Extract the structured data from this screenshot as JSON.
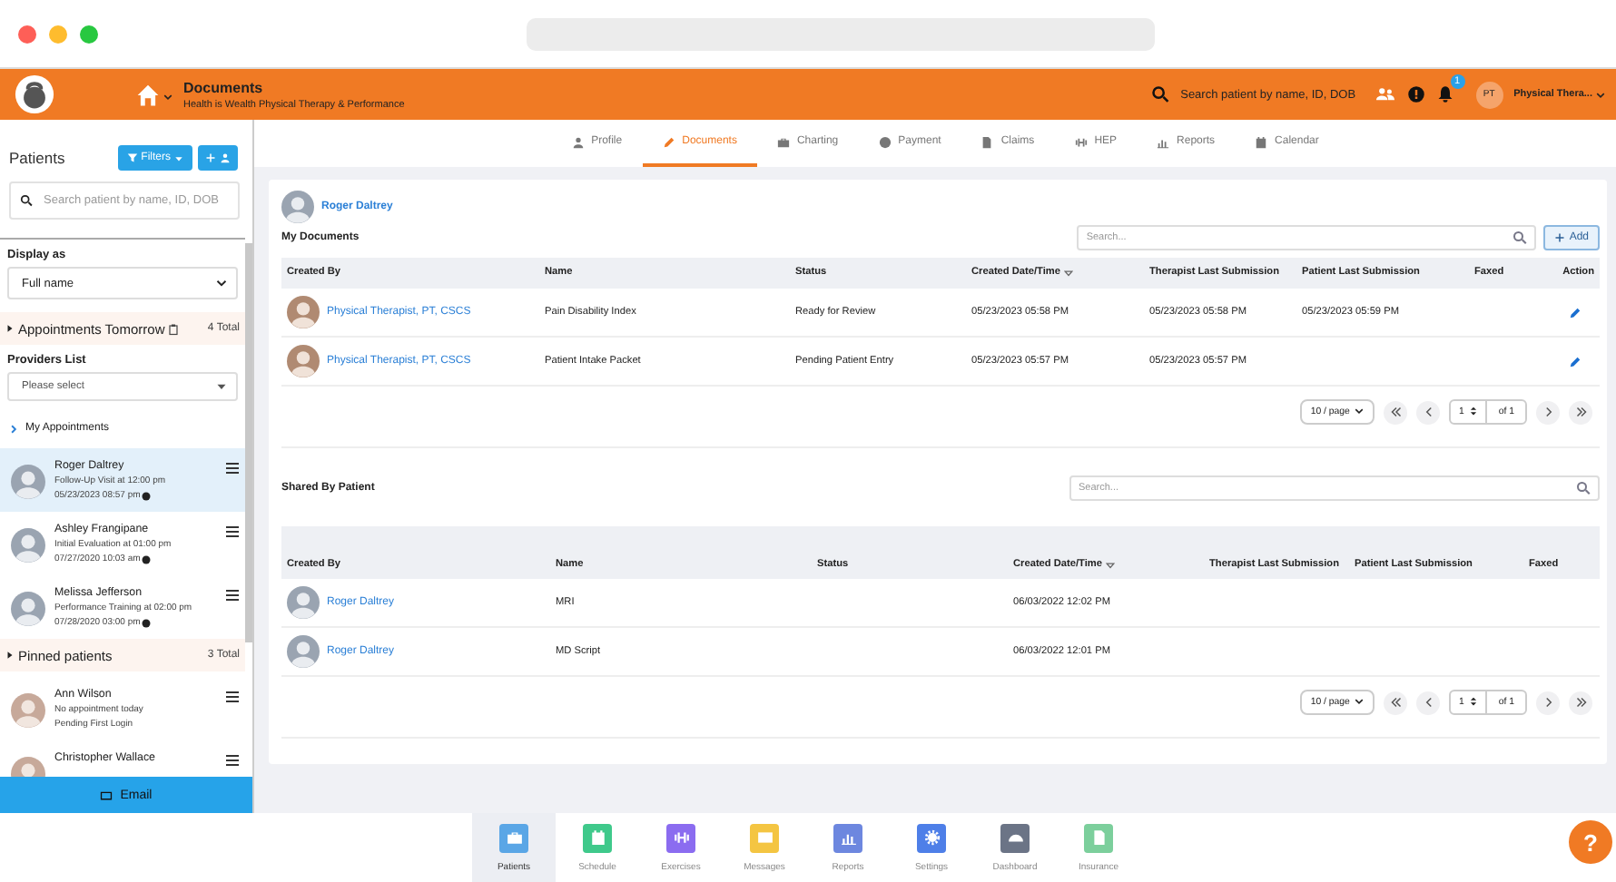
{
  "header": {
    "title": "Documents",
    "subtitle": "Health is Wealth Physical Therapy & Performance",
    "search_placeholder": "Search patient by name, ID, DOB",
    "notification_count": "1",
    "user_initials": "PT",
    "user_name": "Physical Thera..."
  },
  "sidebar": {
    "title": "Patients",
    "filters_button": "Filters",
    "search_placeholder": "Search patient by name, ID, DOB",
    "display_as_label": "Display as",
    "display_as_value": "Full name",
    "appointments_section": {
      "title": "Appointments Tomorrow",
      "total": "4 Total"
    },
    "providers_label": "Providers List",
    "providers_placeholder": "Please select",
    "my_appointments": "My Appointments",
    "appointments": [
      {
        "name": "Roger Daltrey",
        "line1": "Follow-Up Visit at 12:00 pm",
        "line2": "05/23/2023 08:57 pm",
        "selected": true
      },
      {
        "name": "Ashley Frangipane",
        "line1": "Initial Evaluation at 01:00 pm",
        "line2": "07/27/2020 10:03 am",
        "selected": false
      },
      {
        "name": "Melissa Jefferson",
        "line1": "Performance Training at 02:00 pm",
        "line2": "07/28/2020 03:00 pm",
        "selected": false
      }
    ],
    "pinned_section": {
      "title": "Pinned patients",
      "total": "3 Total"
    },
    "pinned": [
      {
        "name": "Ann Wilson",
        "line1": "No appointment today",
        "line2": "Pending First Login"
      },
      {
        "name": "Christopher Wallace"
      }
    ],
    "email_button": "Email"
  },
  "tabs": [
    {
      "label": "Profile",
      "selected": false
    },
    {
      "label": "Documents",
      "selected": true
    },
    {
      "label": "Charting",
      "selected": false
    },
    {
      "label": "Payment",
      "selected": false
    },
    {
      "label": "Claims",
      "selected": false
    },
    {
      "label": "HEP",
      "selected": false
    },
    {
      "label": "Reports",
      "selected": false
    },
    {
      "label": "Calendar",
      "selected": false
    }
  ],
  "patient_name": "Roger Daltrey",
  "my_documents": {
    "title": "My Documents",
    "search_placeholder": "Search...",
    "add_button": "Add",
    "columns": [
      {
        "label": "Created By",
        "sorted": false
      },
      {
        "label": "Name",
        "sorted": false
      },
      {
        "label": "Status",
        "sorted": false
      },
      {
        "label": "Created Date/Time",
        "sorted": true
      },
      {
        "label": "Therapist Last Submission",
        "sorted": false
      },
      {
        "label": "Patient Last Submission",
        "sorted": false
      },
      {
        "label": "Faxed",
        "sorted": false
      },
      {
        "label": "Action",
        "sorted": false
      }
    ],
    "rows": [
      {
        "cells": [
          "Physical Therapist, PT, CSCS",
          "Pain Disability Index",
          "Ready for Review",
          "05/23/2023 05:58 PM",
          "05/23/2023 05:58 PM",
          "05/23/2023 05:59 PM"
        ]
      },
      {
        "cells": [
          "Physical Therapist, PT, CSCS",
          "Patient Intake Packet",
          "Pending Patient Entry",
          "05/23/2023 05:57 PM",
          "05/23/2023 05:57 PM"
        ]
      }
    ],
    "pagination": {
      "per_page": "10 / page",
      "page": "1",
      "of": "of 1"
    }
  },
  "shared_by_patient": {
    "title": "Shared By Patient",
    "search_placeholder": "Search...",
    "columns": [
      {
        "label": "Created By",
        "sorted": false
      },
      {
        "label": "Name",
        "sorted": false
      },
      {
        "label": "Status",
        "sorted": false
      },
      {
        "label": "Created Date/Time",
        "sorted": true
      },
      {
        "label": "Therapist Last Submission",
        "sorted": false
      },
      {
        "label": "Patient Last Submission",
        "sorted": false
      },
      {
        "label": "Faxed",
        "sorted": false
      }
    ],
    "rows": [
      {
        "cells": [
          "Roger Daltrey",
          "MRI",
          "",
          "06/03/2022 12:02 PM"
        ]
      },
      {
        "cells": [
          "Roger Daltrey",
          "MD Script",
          "",
          "06/03/2022 12:01 PM"
        ]
      }
    ],
    "pagination": {
      "per_page": "10 / page",
      "page": "1",
      "of": "of 1"
    }
  },
  "bottom_nav": [
    {
      "label": "Patients",
      "color": "#5aa6e6",
      "selected": true
    },
    {
      "label": "Schedule",
      "color": "#3fc98b",
      "selected": false
    },
    {
      "label": "Exercises",
      "color": "#8b6cf0",
      "selected": false
    },
    {
      "label": "Messages",
      "color": "#f4c542",
      "selected": false
    },
    {
      "label": "Reports",
      "color": "#6d87df",
      "selected": false
    },
    {
      "label": "Settings",
      "color": "#4e7fe8",
      "selected": false
    },
    {
      "label": "Dashboard",
      "color": "#6b7486",
      "selected": false
    },
    {
      "label": "Insurance",
      "color": "#7ccf9c",
      "selected": false
    }
  ],
  "help_button": "?"
}
